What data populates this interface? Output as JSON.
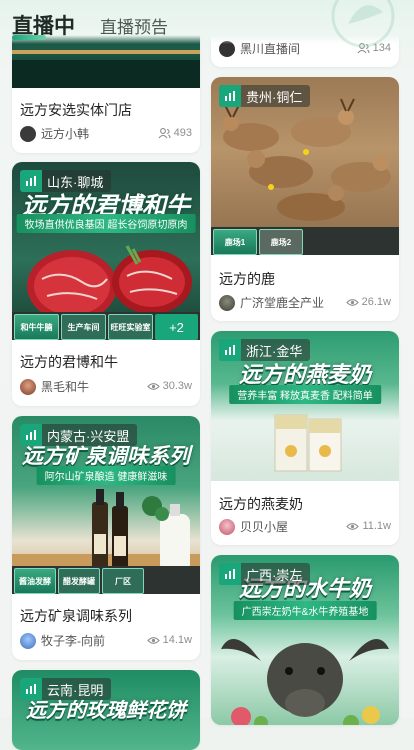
{
  "tabs": {
    "live": "直播中",
    "preview": "直播预告"
  },
  "left_column": [
    {
      "title": "远方安选实体门店",
      "author": "远方小韩",
      "stat": "493",
      "stat_icon": "people-icon"
    },
    {
      "location": "山东·聊城",
      "poster_title": "远方的君博和牛",
      "poster_sub": "牧场直供优良基因 超长谷饲原切原肉",
      "thumbs": [
        "和牛牛腩",
        "生产车间",
        "旺旺实验室",
        "+2"
      ],
      "title": "远方的君博和牛",
      "author": "黑毛和牛",
      "stat": "30.3w",
      "stat_icon": "eye-icon"
    },
    {
      "location": "内蒙古·兴安盟",
      "poster_title": "远方矿泉调味系列",
      "poster_sub": "阿尔山矿泉酿造 健康鲜滋味",
      "thumbs": [
        "酱油发酵",
        "醋发酵罐",
        "厂区"
      ],
      "title": "远方矿泉调味系列",
      "author": "牧子李-向前",
      "stat": "14.1w",
      "stat_icon": "eye-icon"
    },
    {
      "location": "云南·昆明",
      "poster_title": "远方的玫瑰鲜花饼"
    }
  ],
  "right_column": [
    {
      "author": "黑川直播间",
      "stat": "134",
      "stat_icon": "people-icon"
    },
    {
      "location": "贵州·铜仁",
      "thumbs": [
        "鹿场1",
        "鹿场2"
      ],
      "title": "远方的鹿",
      "author": "广济堂鹿全产业",
      "stat": "26.1w",
      "stat_icon": "eye-icon"
    },
    {
      "location": "浙江·金华",
      "poster_title": "远方的燕麦奶",
      "poster_sub": "营养丰富 释放真麦香 配料简单",
      "title": "远方的燕麦奶",
      "author": "贝贝小屋",
      "stat": "11.1w",
      "stat_icon": "eye-icon"
    },
    {
      "location": "广西·崇左",
      "poster_title": "远方的水牛奶",
      "poster_sub": "广西崇左奶牛&水牛养殖基地"
    }
  ],
  "colors": {
    "accent": "#1aa67b",
    "tag_bg": "#1aa67b",
    "text": "#222222"
  }
}
